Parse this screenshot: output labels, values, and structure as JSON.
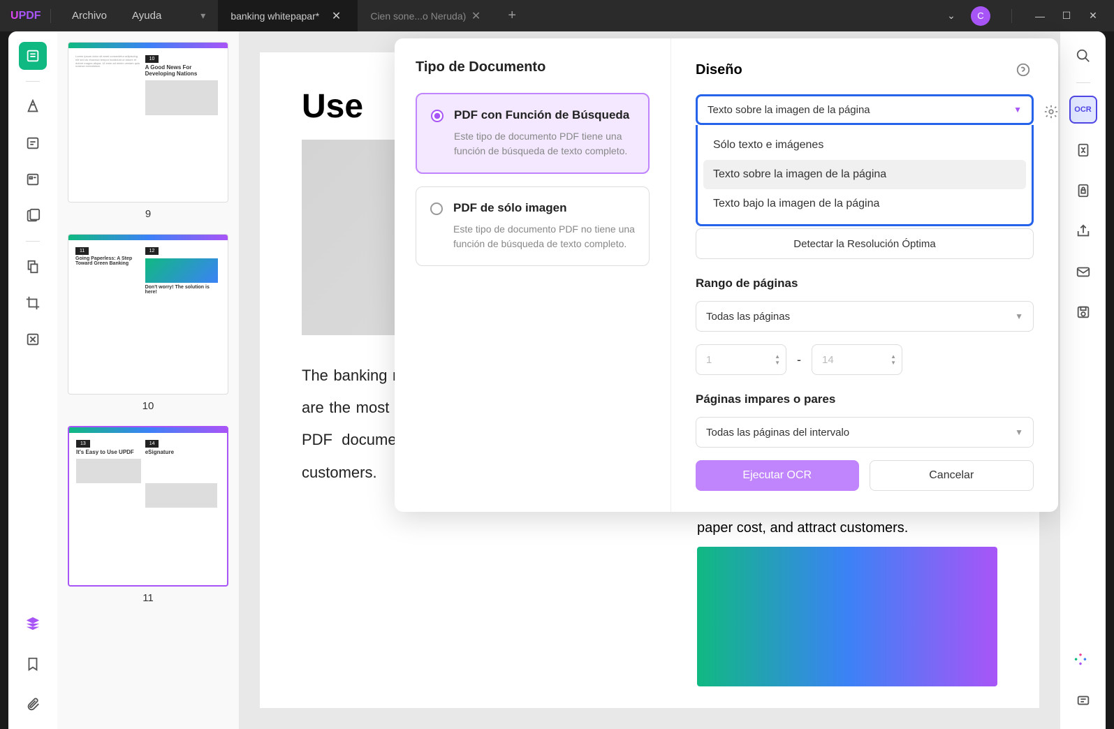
{
  "menu": {
    "archivo": "Archivo",
    "ayuda": "Ayuda"
  },
  "tabs": {
    "active": {
      "title": "banking whitepapar*"
    },
    "inactive": {
      "title": "Cien sone...o Neruda)"
    }
  },
  "avatar": "C",
  "thumbnails": {
    "page9": {
      "num": "9",
      "badge": "10",
      "title": "A Good News For Developing Nations"
    },
    "page10": {
      "num": "10",
      "badge1": "11",
      "badge2": "12",
      "title1": "Going Paperless: A Step Toward Green Banking",
      "title2": "Don't worry! The solution is here!"
    },
    "page11": {
      "num": "11",
      "badge1": "13",
      "badge2": "14",
      "title1": "It's Easy to Use UPDF",
      "title2": "eSignature"
    }
  },
  "document": {
    "title": "Use",
    "body": "The banking money t its empl nient; its tasks without any skills. Moreover, its flexible design features are the most contestant for business professionals, students, and anyone who needs to do stuff with PDF documents. UPDF is compelled to provide long-run benefits to banks/financial firms, and customers.",
    "caption": "paper cost, and attract customers."
  },
  "ocr_panel": {
    "doc_type_title": "Tipo de Documento",
    "opt1_label": "PDF con Función de Búsqueda",
    "opt1_desc": "Este tipo de documento PDF tiene una función de búsqueda de texto completo.",
    "opt2_label": "PDF de sólo imagen",
    "opt2_desc": "Este tipo de documento PDF no tiene una función de búsqueda de texto completo.",
    "design_title": "Diseño",
    "select_value": "Texto sobre la imagen de la página",
    "dd_opt1": "Sólo texto e imágenes",
    "dd_opt2": "Texto sobre la imagen de la página",
    "dd_opt3": "Texto bajo la imagen de la página",
    "detect_btn": "Detectar la Resolución Óptima",
    "range_title": "Rango de páginas",
    "range_all": "Todas las páginas",
    "range_from": "1",
    "range_to": "14",
    "parity_title": "Páginas impares o pares",
    "parity_value": "Todas las páginas del intervalo",
    "run_btn": "Ejecutar OCR",
    "cancel_btn": "Cancelar"
  }
}
